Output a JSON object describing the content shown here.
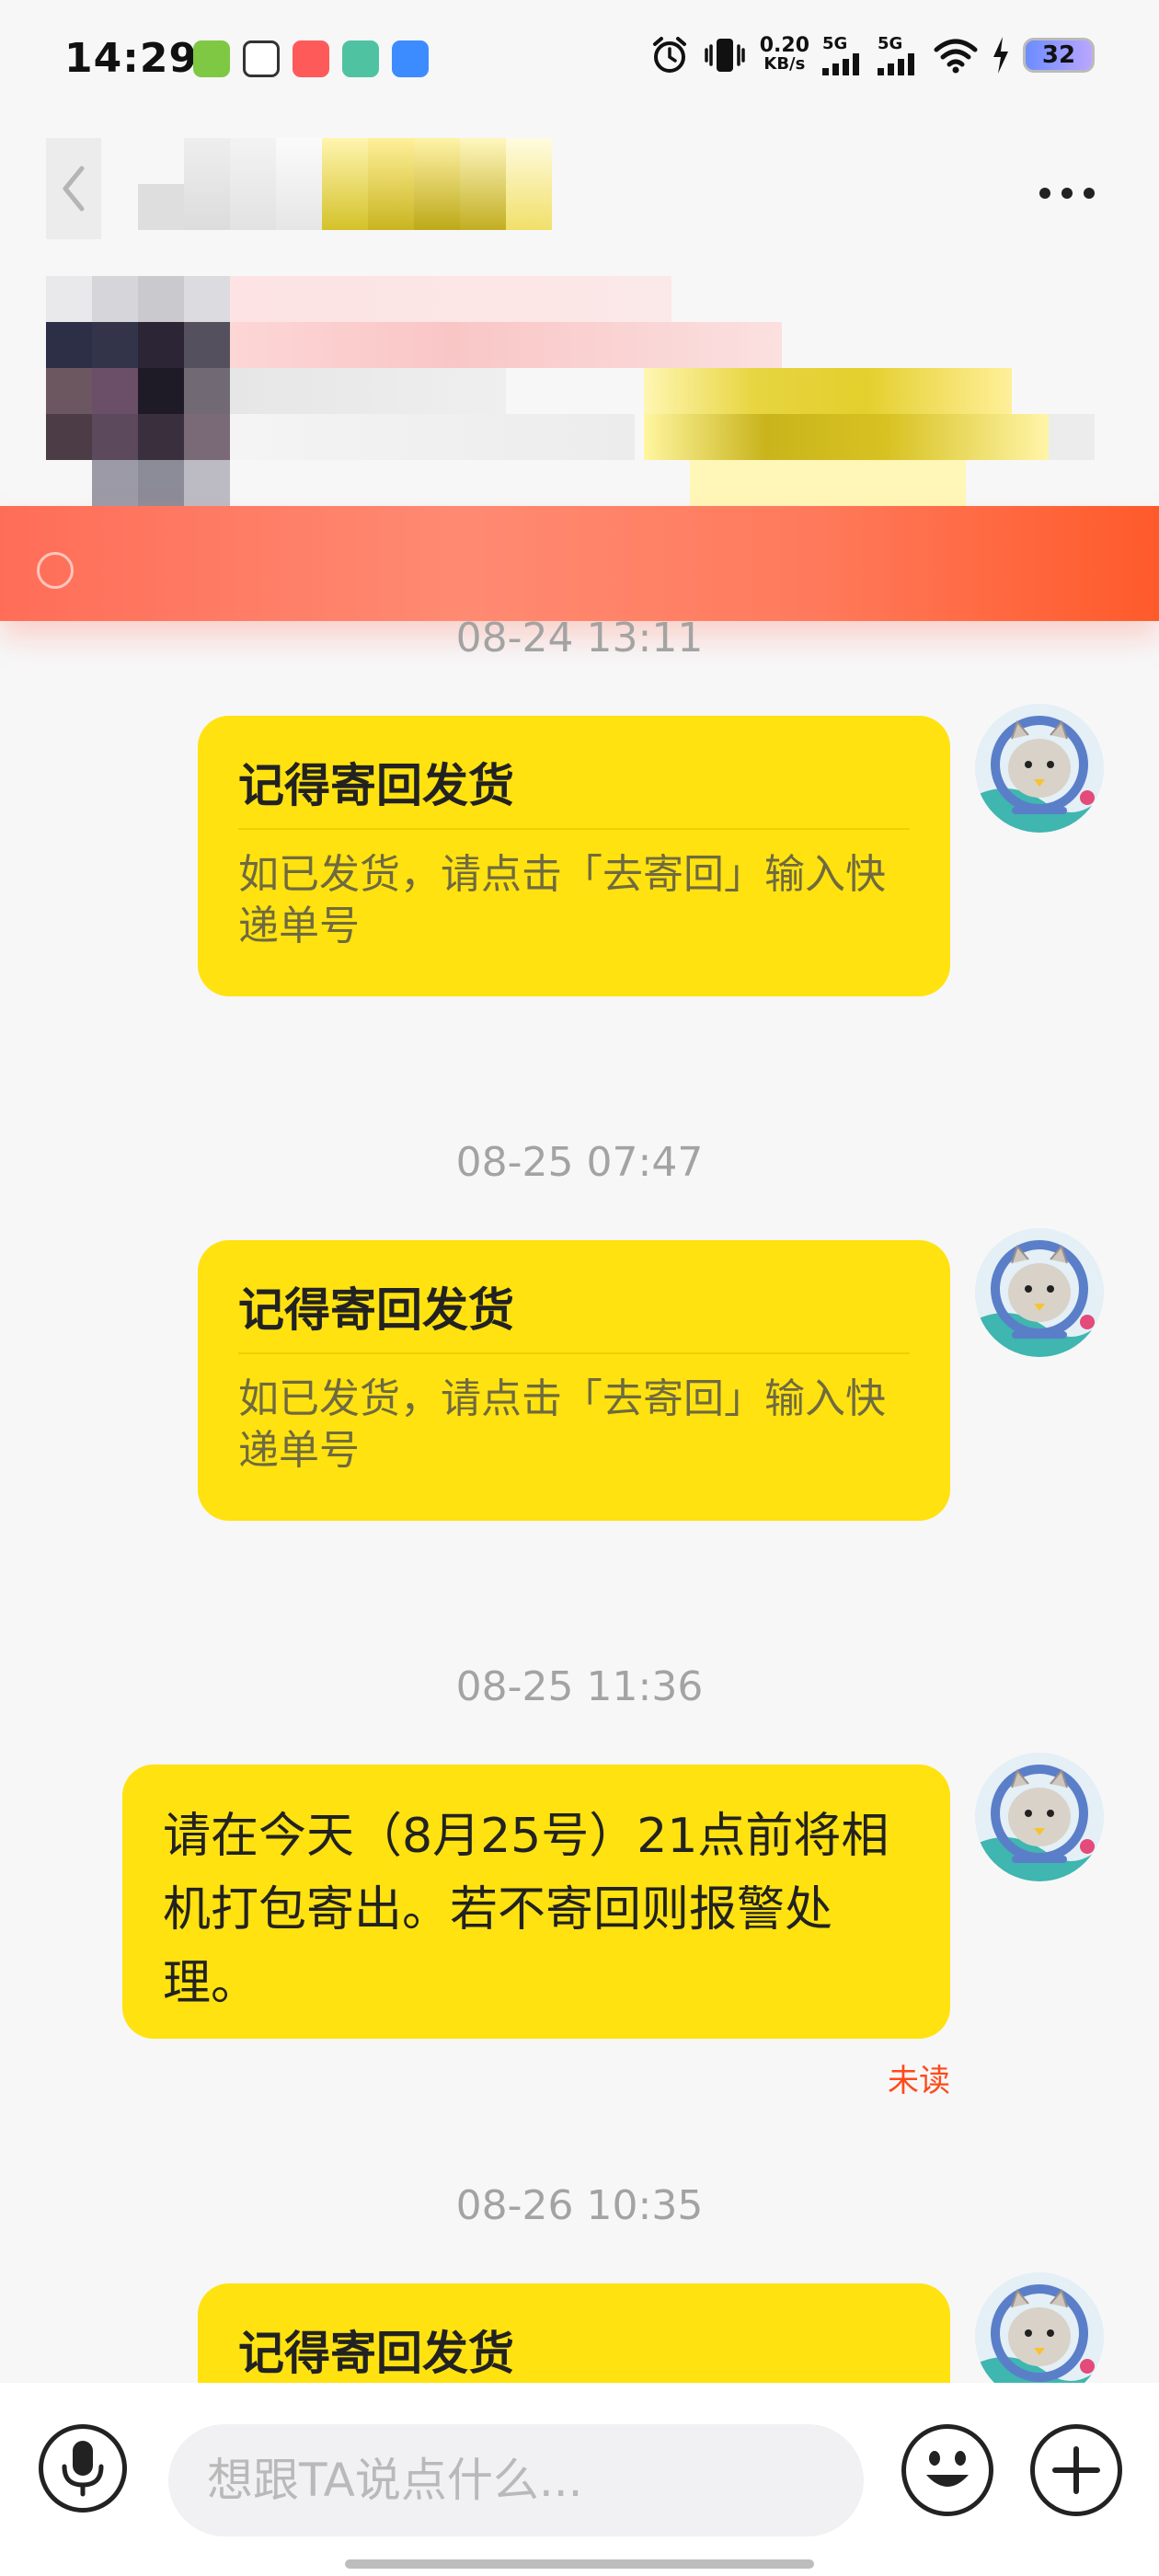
{
  "status_bar": {
    "time": "14:29",
    "net_speed_value": "0.20",
    "net_speed_unit": "KB/s",
    "signal_1": "5G",
    "signal_2": "5G",
    "battery": "32"
  },
  "header": {
    "back_icon": "chevron-left-icon",
    "more_icon": "more-horizontal-icon"
  },
  "colors": {
    "bubble": "#ffe20f",
    "background": "#f7f7f8",
    "unread": "#ff4a1a",
    "timestamp": "#a3a3a3",
    "warning_banner": "#ff6d57"
  },
  "messages": [
    {
      "timestamp": "08-24 13:11",
      "type": "card",
      "title": "记得寄回发货",
      "body": "如已发货，请点击「去寄回」输入快递单号"
    },
    {
      "timestamp": "08-25 07:47",
      "type": "card",
      "title": "记得寄回发货",
      "body": "如已发货，请点击「去寄回」输入快递单号"
    },
    {
      "timestamp": "08-25 11:36",
      "type": "text",
      "body": "请在今天（8月25号）21点前将相机打包寄出。若不寄回则报警处理。",
      "status": "未读"
    },
    {
      "timestamp": "08-26 10:35",
      "type": "card",
      "title": "记得寄回发货"
    }
  ],
  "input_bar": {
    "placeholder": "想跟TA说点什么...",
    "voice_icon": "microphone-icon",
    "emoji_icon": "emoji-smile-icon",
    "plus_icon": "plus-circle-icon"
  }
}
